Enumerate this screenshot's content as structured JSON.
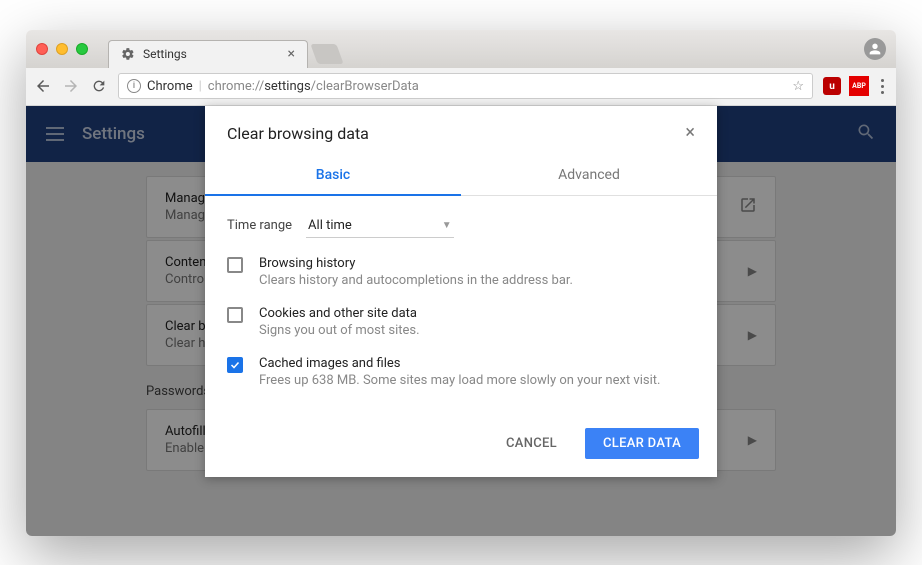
{
  "window": {
    "tab_title": "Settings",
    "avatar": "user-icon"
  },
  "toolbar": {
    "url_prefix": "Chrome",
    "url_scheme": "chrome://",
    "url_host": "settings",
    "url_path": "/clearBrowserData",
    "ext_u": "u",
    "ext_abp": "ABP"
  },
  "settings": {
    "header_title": "Settings",
    "cards": [
      {
        "title": "Manage certificates",
        "sub": "Manage HTTPS/SSL certificates and settings",
        "icon": "launch"
      },
      {
        "title": "Content settings",
        "sub": "Control what information websites can use and what content they can show you",
        "icon": "chevron"
      },
      {
        "title": "Clear browsing data",
        "sub": "Clear history, cookies, cache, and more",
        "icon": "chevron"
      }
    ],
    "section_label": "Passwords and forms",
    "cards2": [
      {
        "title": "Autofill settings",
        "sub": "Enable Autofill to fill out forms in a single click",
        "icon": "chevron"
      }
    ]
  },
  "dialog": {
    "title": "Clear browsing data",
    "tabs": {
      "basic": "Basic",
      "advanced": "Advanced"
    },
    "time_label": "Time range",
    "time_value": "All time",
    "checks": [
      {
        "title": "Browsing history",
        "sub": "Clears history and autocompletions in the address bar.",
        "checked": false
      },
      {
        "title": "Cookies and other site data",
        "sub": "Signs you out of most sites.",
        "checked": false
      },
      {
        "title": "Cached images and files",
        "sub": "Frees up 638 MB. Some sites may load more slowly on your next visit.",
        "checked": true
      }
    ],
    "cancel": "CANCEL",
    "clear": "CLEAR DATA"
  }
}
